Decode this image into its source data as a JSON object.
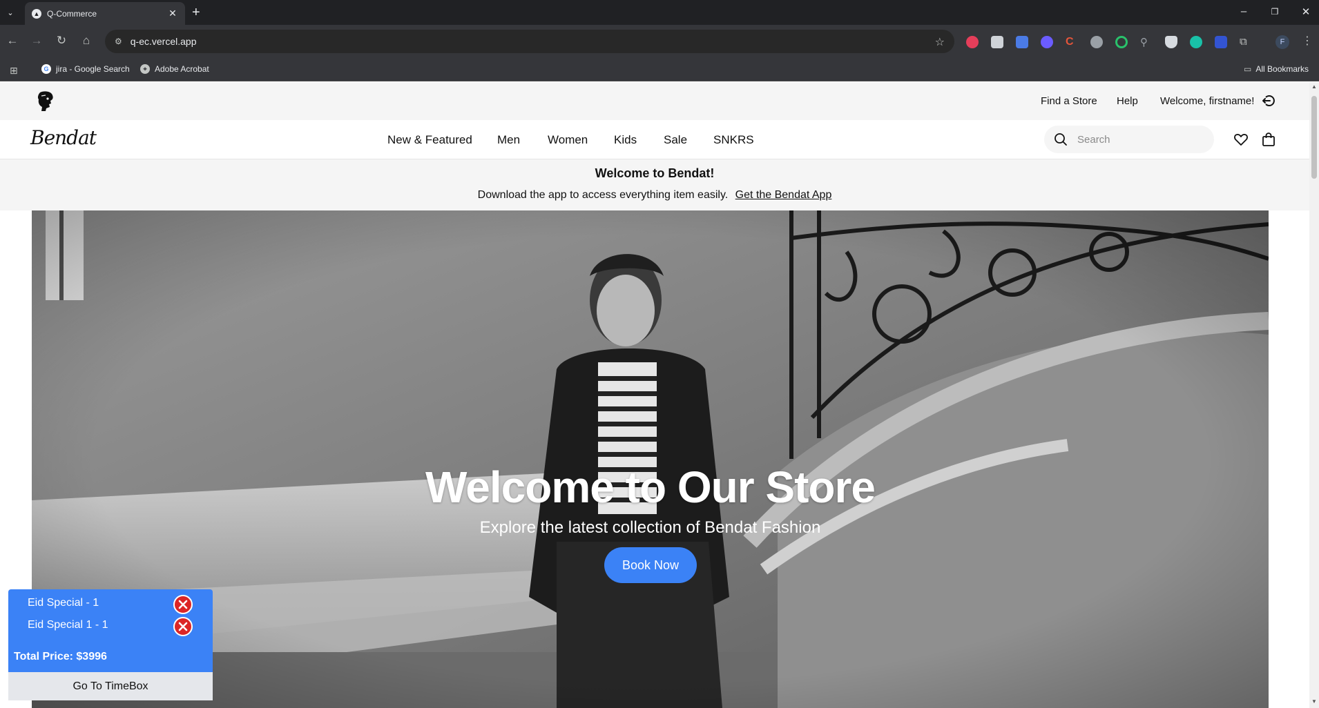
{
  "browser": {
    "tab_title": "Q-Commerce",
    "url": "q-ec.vercel.app",
    "bookmarks": [
      {
        "label": "jira - Google Search",
        "icon": "google-icon"
      },
      {
        "label": "Adobe Acrobat",
        "icon": "acrobat-icon"
      }
    ],
    "all_bookmarks_label": "All Bookmarks",
    "profile_initial": "F"
  },
  "site": {
    "utility_links": {
      "find_store": "Find a Store",
      "help": "Help",
      "welcome": "Welcome, firstname!"
    },
    "wordmark": "Bendat",
    "nav": [
      "New & Featured",
      "Men",
      "Women",
      "Kids",
      "Sale",
      "SNKRS"
    ],
    "search_placeholder": "Search",
    "promo": {
      "title": "Welcome to Bendat!",
      "text": "Download the app to access everything item easily.",
      "link": "Get the Bendat App"
    },
    "hero": {
      "title": "Welcome to Our Store",
      "subtitle": "Explore the latest collection of Bendat Fashion",
      "cta": "Book Now"
    },
    "cart": {
      "items": [
        "Eid Special - 1",
        "Eid Special 1 - 1"
      ],
      "total": "Total Price: $3996",
      "go_button": "Go To TimeBox"
    }
  },
  "colors": {
    "accent": "#3b82f6",
    "chrome_dark": "#202124",
    "remove_red": "#dc2626"
  }
}
